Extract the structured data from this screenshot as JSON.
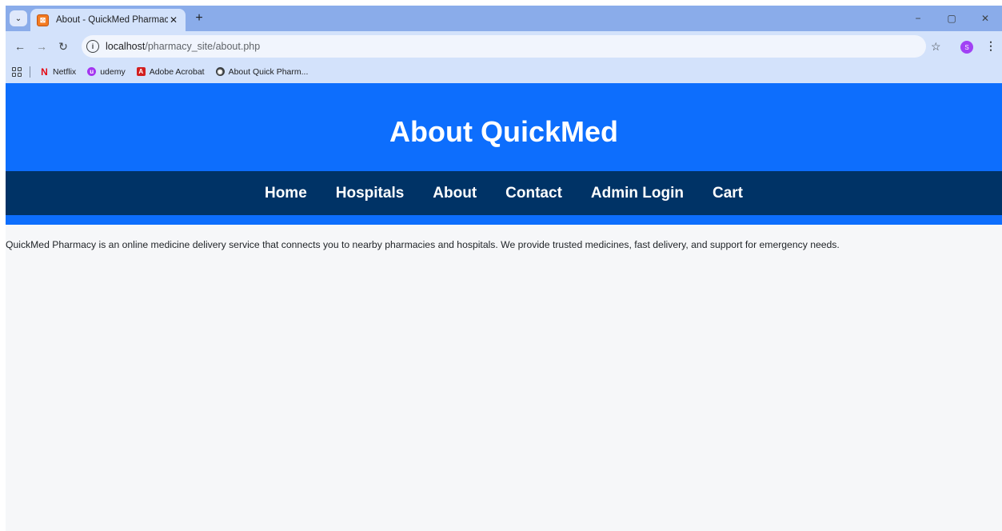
{
  "browser": {
    "tab": {
      "title": "About - QuickMed Pharmacy"
    },
    "window_controls": [
      "−",
      "▢",
      "✕"
    ],
    "address_bar": {
      "host": "localhost",
      "path": "/pharmacy_site/about.php"
    },
    "profile_initial": "S",
    "bookmarks": [
      {
        "label": "Netflix",
        "icon": "netflix-icon"
      },
      {
        "label": "udemy",
        "icon": "udemy-icon"
      },
      {
        "label": "Adobe Acrobat",
        "icon": "adobe-acrobat-icon"
      },
      {
        "label": "About Quick Pharm...",
        "icon": "globe-icon"
      }
    ]
  },
  "page": {
    "title": "About QuickMed",
    "nav": [
      "Home",
      "Hospitals",
      "About",
      "Contact",
      "Admin Login",
      "Cart"
    ],
    "body_text": "QuickMed Pharmacy is an online medicine delivery service that connects you to nearby pharmacies and hospitals. We provide trusted medicines, fast delivery, and support for emergency needs."
  },
  "colors": {
    "header_blue": "#0d6efd",
    "nav_navy": "#003366",
    "tabstrip": "#8aacea",
    "toolbar": "#d3e2fb"
  }
}
